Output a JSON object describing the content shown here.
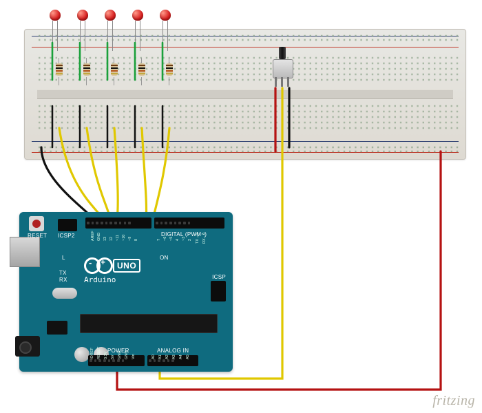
{
  "diagram": {
    "tool_watermark": "fritzing",
    "board": {
      "name": "Arduino",
      "model": "UNO",
      "reset_label": "RESET",
      "icsp2_label": "ICSP2",
      "icsp_label": "ICSP",
      "on_label": "ON",
      "tx_label": "TX",
      "rx_label": "RX",
      "l_label": "L",
      "digital_section_label": "DIGITAL (PWM~)",
      "power_section_label": "POWER",
      "analog_section_label": "ANALOG IN",
      "top_pins": [
        "AREF",
        "GND",
        "13",
        "12",
        "~11",
        "~10",
        "~9",
        "8",
        "7",
        "~6",
        "~5",
        "4",
        "~3",
        "2",
        "TX→1",
        "RX←0"
      ],
      "bottom_pins": [
        "IOREF",
        "RESET",
        "3.3V",
        "5V",
        "GND",
        "GND",
        "Vin",
        "A0",
        "A1",
        "A2",
        "A3",
        "A4",
        "A5"
      ]
    },
    "components": {
      "leds": [
        {
          "id": "led1",
          "color": "red"
        },
        {
          "id": "led2",
          "color": "red"
        },
        {
          "id": "led3",
          "color": "red"
        },
        {
          "id": "led4",
          "color": "red"
        },
        {
          "id": "led5",
          "color": "red"
        }
      ],
      "resistors": 5,
      "potentiometer": {
        "pins": 3
      }
    },
    "wiring": {
      "led_signal_pins": [
        "12",
        "11",
        "10",
        "7",
        "6"
      ],
      "pot_wiper_pin": "A0",
      "pot_vcc_pin": "5V",
      "pot_gnd": "GND-rail",
      "gnd_jumper_pin": "GND",
      "wire_colors": {
        "signal": "yellow",
        "ground": "black",
        "power": "red"
      }
    }
  }
}
